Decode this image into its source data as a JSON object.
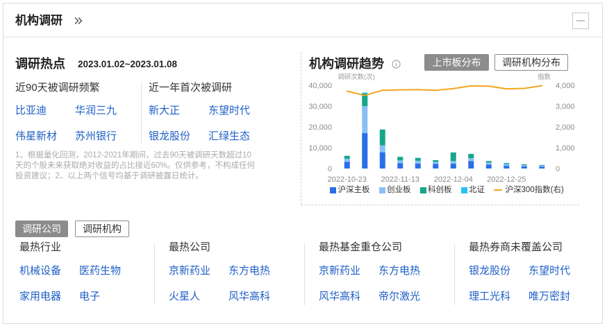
{
  "header": {
    "title": "机构调研",
    "title_icon": "double-chevron-right-icon",
    "collapse_icon": "minus-square-icon"
  },
  "hot": {
    "title": "调研热点",
    "date_range": "2023.01.02~2023.01.08",
    "groups": [
      {
        "label": "近90天被调研频繁",
        "items": [
          "比亚迪",
          "华润三九",
          "伟星新材",
          "苏州银行"
        ]
      },
      {
        "label": "近一年首次被调研",
        "items": [
          "新大正",
          "东望时代",
          "银龙股份",
          "汇绿生态"
        ]
      }
    ],
    "note": "1、根据量化回测，2012-2021年期间，过去90天被调研天数超过10天的个股未来获取绝对收益的占比接近60%。仅供参考，不构成任何投资建议；2、以上两个信号均基于调研披露日统计。"
  },
  "trend": {
    "info_icon": "info-circle-icon",
    "tabs": [
      {
        "label": "上市板分布",
        "active": true
      },
      {
        "label": "调研机构分布",
        "active": false
      }
    ]
  },
  "chart_data": {
    "type": "bar",
    "stacked": true,
    "title": "机构调研趋势",
    "ylabel": "调研次数(次)",
    "y2label": "指数",
    "ylim": [
      0,
      40000
    ],
    "y2lim": [
      0,
      4000
    ],
    "yticks": [
      "0",
      "10,000",
      "20,000",
      "30,000",
      "40,000"
    ],
    "y2ticks": [
      "0",
      "1,000",
      "2,000",
      "3,000",
      "4,000"
    ],
    "categories": [
      "2022-10-23",
      "",
      "",
      "2022-11-13",
      "",
      "",
      "2022-12-04",
      "",
      "",
      "2022-12-25",
      "",
      ""
    ],
    "series": [
      {
        "name": "沪深主板",
        "color": "#2a6fe6",
        "values": [
          3200,
          17000,
          7800,
          2600,
          2400,
          2200,
          2300,
          3600,
          1900,
          1300,
          1000,
          900
        ]
      },
      {
        "name": "创业板",
        "color": "#88c0f4",
        "values": [
          1500,
          13000,
          3300,
          1300,
          1300,
          1000,
          1300,
          1400,
          1000,
          800,
          600,
          500
        ]
      },
      {
        "name": "科创板",
        "color": "#16a689",
        "values": [
          1400,
          6000,
          7600,
          1700,
          1400,
          800,
          4100,
          2000,
          700,
          500,
          400,
          300
        ]
      },
      {
        "name": "北证",
        "color": "#27c2f0",
        "values": [
          50,
          500,
          100,
          50,
          50,
          50,
          50,
          50,
          50,
          50,
          30,
          30
        ]
      }
    ],
    "y2_series": {
      "name": "沪深300指数(右)",
      "color": "#f2a51d",
      "values": [
        3720,
        3510,
        3760,
        3780,
        3790,
        3760,
        3840,
        3970,
        3960,
        3830,
        3850,
        3980
      ]
    },
    "grid": false,
    "legend_position": "bottom"
  },
  "bottom": {
    "tabs": [
      {
        "label": "调研公司",
        "active": true
      },
      {
        "label": "调研机构",
        "active": false
      }
    ],
    "columns": [
      {
        "title": "最热行业",
        "items": [
          "机械设备",
          "医药生物",
          "家用电器",
          "电子"
        ]
      },
      {
        "title": "最热公司",
        "items": [
          "京新药业",
          "东方电热",
          "火星人",
          "风华高科"
        ]
      },
      {
        "title": "最热基金重仓公司",
        "items": [
          "京新药业",
          "东方电热",
          "风华高科",
          "帝尔激光"
        ]
      },
      {
        "title": "最热券商未覆盖公司",
        "items": [
          "银龙股份",
          "东望时代",
          "理工光科",
          "唯万密封"
        ]
      }
    ]
  },
  "colors": {
    "link": "#1e5fc6",
    "active_tab": "#8c8c8c"
  }
}
